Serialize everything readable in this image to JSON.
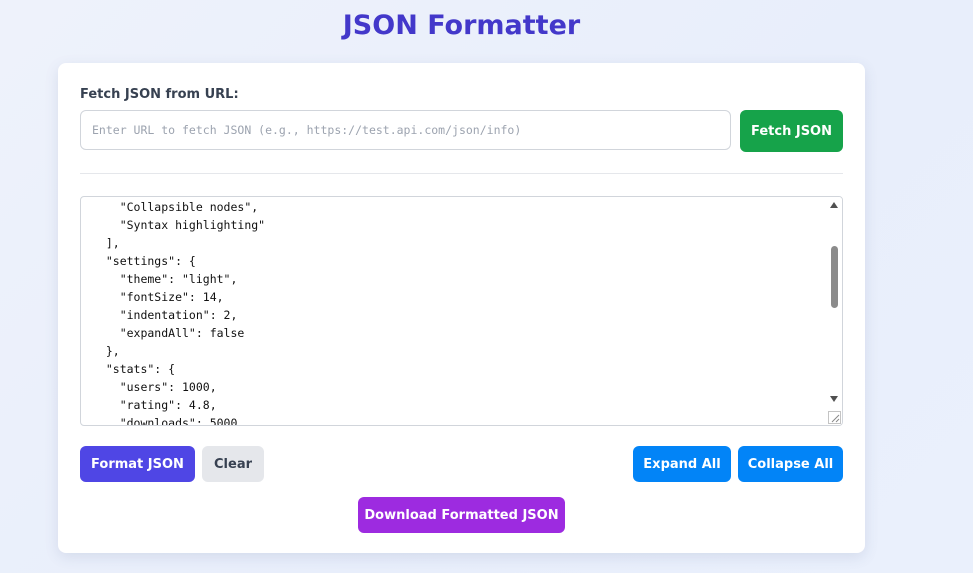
{
  "page": {
    "title": "JSON Formatter"
  },
  "fetch": {
    "label": "Fetch JSON from URL:",
    "url_placeholder": "Enter URL to fetch JSON (e.g., https://test.api.com/json/info)",
    "url_value": "",
    "button_label": "Fetch JSON"
  },
  "editor": {
    "lines": [
      "    \"Collapsible nodes\",",
      "    \"Syntax highlighting\"",
      "  ],",
      "  \"settings\": {",
      "    \"theme\": \"light\",",
      "    \"fontSize\": 14,",
      "    \"indentation\": 2,",
      "    \"expandAll\": false",
      "  },",
      "  \"stats\": {",
      "    \"users\": 1000,",
      "    \"rating\": 4.8,",
      "    \"downloads\": 5000"
    ],
    "scroll_position": 0.35
  },
  "actions": {
    "format_label": "Format JSON",
    "clear_label": "Clear",
    "expand_label": "Expand All",
    "collapse_label": "Collapse All",
    "download_label": "Download Formatted JSON"
  },
  "colors": {
    "title": "#4338ca",
    "fetch_button": "#16a34a",
    "format_button": "#4f46e5",
    "clear_button": "#e5e7eb",
    "expand_collapse_buttons": "#0284f7",
    "download_button": "#9d2be0"
  },
  "icons": {
    "scroll_up": "scroll-up-arrow-icon",
    "scroll_down": "scroll-down-arrow-icon",
    "resize": "resize-grip-icon"
  }
}
